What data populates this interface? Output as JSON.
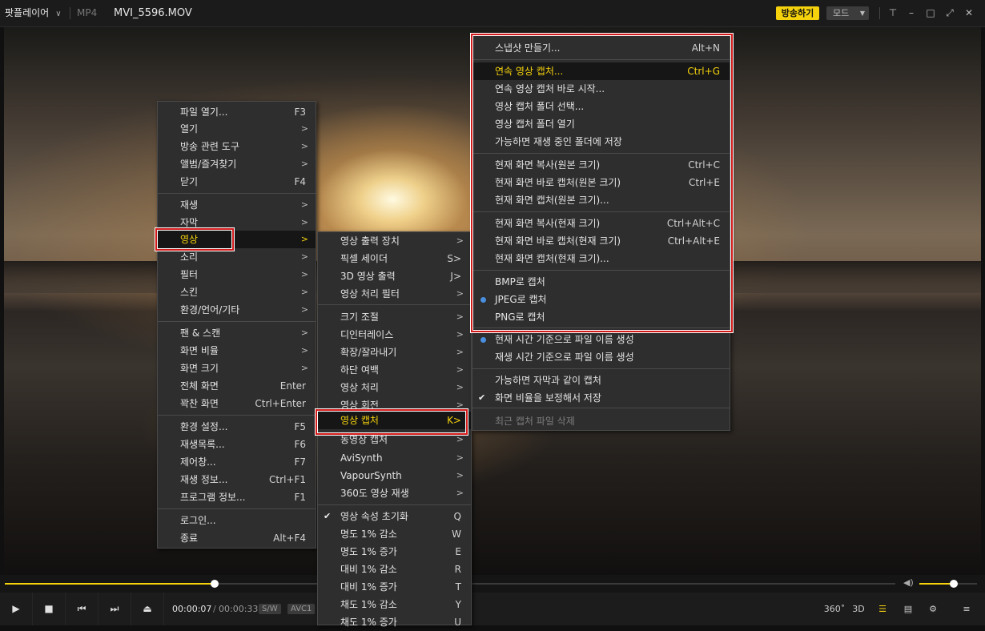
{
  "titlebar": {
    "app_menu": "팟플레이어",
    "format": "MP4",
    "filename": "MVI_5596.MOV",
    "broadcast_button": "방송하기",
    "mode_button": "모드"
  },
  "playback": {
    "current_time": "00:00:07",
    "separator": "/",
    "total_time": "00:00:33",
    "decoder_badge": "S/W",
    "codec_badge": "AVC1",
    "progress_fraction": 0.236,
    "volume_fraction": 0.6,
    "degree_360": "360˚",
    "label_3d": "3D"
  },
  "icons": {
    "colors": {
      "accent": "#f5d20c",
      "highlight_bg": "#161616",
      "menu_bg": "#2e2e2e",
      "radio": "#4a8fdf",
      "annotation": "#d31a1a"
    }
  },
  "menu_main": {
    "items": [
      {
        "label": "파일 열기...",
        "shortcut": "F3"
      },
      {
        "label": "열기",
        "submenu": true
      },
      {
        "label": "방송 관련 도구",
        "submenu": true
      },
      {
        "label": "앨범/즐겨찾기",
        "submenu": true
      },
      {
        "label": "닫기",
        "shortcut": "F4"
      },
      {
        "label": "재생",
        "submenu": true
      },
      {
        "label": "자막",
        "submenu": true
      },
      {
        "label": "영상",
        "submenu": true,
        "highlighted": true
      },
      {
        "label": "소리",
        "submenu": true
      },
      {
        "label": "필터",
        "submenu": true
      },
      {
        "label": "스킨",
        "submenu": true
      },
      {
        "label": "환경/언어/기타",
        "submenu": true
      },
      {
        "label": "팬 & 스캔",
        "submenu": true
      },
      {
        "label": "화면 비율",
        "submenu": true
      },
      {
        "label": "화면 크기",
        "submenu": true
      },
      {
        "label": "전체 화면",
        "shortcut": "Enter"
      },
      {
        "label": "꽉찬 화면",
        "shortcut": "Ctrl+Enter"
      },
      {
        "label": "환경 설정...",
        "shortcut": "F5"
      },
      {
        "label": "재생목록...",
        "shortcut": "F6"
      },
      {
        "label": "제어창...",
        "shortcut": "F7"
      },
      {
        "label": "재생 정보...",
        "shortcut": "Ctrl+F1"
      },
      {
        "label": "프로그램 정보...",
        "shortcut": "F1"
      },
      {
        "label": "로그인..."
      },
      {
        "label": "종료",
        "shortcut": "Alt+F4"
      }
    ]
  },
  "menu_video": {
    "items": [
      {
        "label": "영상 출력 장치",
        "submenu": true
      },
      {
        "label": "픽셀 세이더",
        "shortcut": "S>"
      },
      {
        "label": "3D 영상 출력",
        "shortcut": "J>"
      },
      {
        "label": "영상 처리 필터",
        "submenu": true
      },
      {
        "label": "크기 조절",
        "submenu": true
      },
      {
        "label": "디인터레이스",
        "submenu": true
      },
      {
        "label": "확장/잘라내기",
        "submenu": true
      },
      {
        "label": "하단 여백",
        "submenu": true
      },
      {
        "label": "영상 처리",
        "submenu": true
      },
      {
        "label": "영상 회전",
        "submenu": true
      },
      {
        "label": "영상 캡처",
        "shortcut": "K>",
        "highlighted": true
      },
      {
        "label": "동영상 캡처",
        "submenu": true
      },
      {
        "label": "AviSynth",
        "submenu": true
      },
      {
        "label": "VapourSynth",
        "submenu": true
      },
      {
        "label": "360도 영상 재생",
        "submenu": true
      },
      {
        "label": "영상 속성 초기화",
        "shortcut": "Q",
        "checked": true
      },
      {
        "label": "명도 1% 감소",
        "shortcut": "W"
      },
      {
        "label": "명도 1% 증가",
        "shortcut": "E"
      },
      {
        "label": "대비 1% 감소",
        "shortcut": "R"
      },
      {
        "label": "대비 1% 증가",
        "shortcut": "T"
      },
      {
        "label": "채도 1% 감소",
        "shortcut": "Y"
      },
      {
        "label": "채도 1% 증가",
        "shortcut": "U"
      }
    ]
  },
  "menu_capture": {
    "items": [
      {
        "label": "스냅샷 만들기...",
        "shortcut": "Alt+N"
      },
      {
        "label": "연속 영상 캡처...",
        "shortcut": "Ctrl+G",
        "highlighted": true
      },
      {
        "label": "연속 영상 캡처 바로 시작..."
      },
      {
        "label": "영상 캡처 폴더 선택..."
      },
      {
        "label": "영상 캡처 폴더 열기"
      },
      {
        "label": "가능하면 재생 중인 폴더에 저장"
      },
      {
        "label": "현재 화면 복사(원본 크기)",
        "shortcut": "Ctrl+C"
      },
      {
        "label": "현재 화면 바로 캡처(원본 크기)",
        "shortcut": "Ctrl+E"
      },
      {
        "label": "현재 화면 캡처(원본 크기)..."
      },
      {
        "label": "현재 화면 복사(현재 크기)",
        "shortcut": "Ctrl+Alt+C"
      },
      {
        "label": "현재 화면 바로 캡처(현재 크기)",
        "shortcut": "Ctrl+Alt+E"
      },
      {
        "label": "현재 화면 캡처(현재 크기)..."
      },
      {
        "label": "BMP로 캡처"
      },
      {
        "label": "JPEG로 캡처",
        "radio": true
      },
      {
        "label": "PNG로 캡처"
      },
      {
        "label": "현재 시간 기준으로 파일 이름 생성",
        "radio": true
      },
      {
        "label": "재생 시간 기준으로 파일 이름 생성"
      },
      {
        "label": "가능하면 자막과 같이 캡처"
      },
      {
        "label": "화면 비율을 보정해서 저장",
        "checked": true
      },
      {
        "label": "최근 캡처 파일 삭제",
        "disabled": true
      }
    ]
  }
}
